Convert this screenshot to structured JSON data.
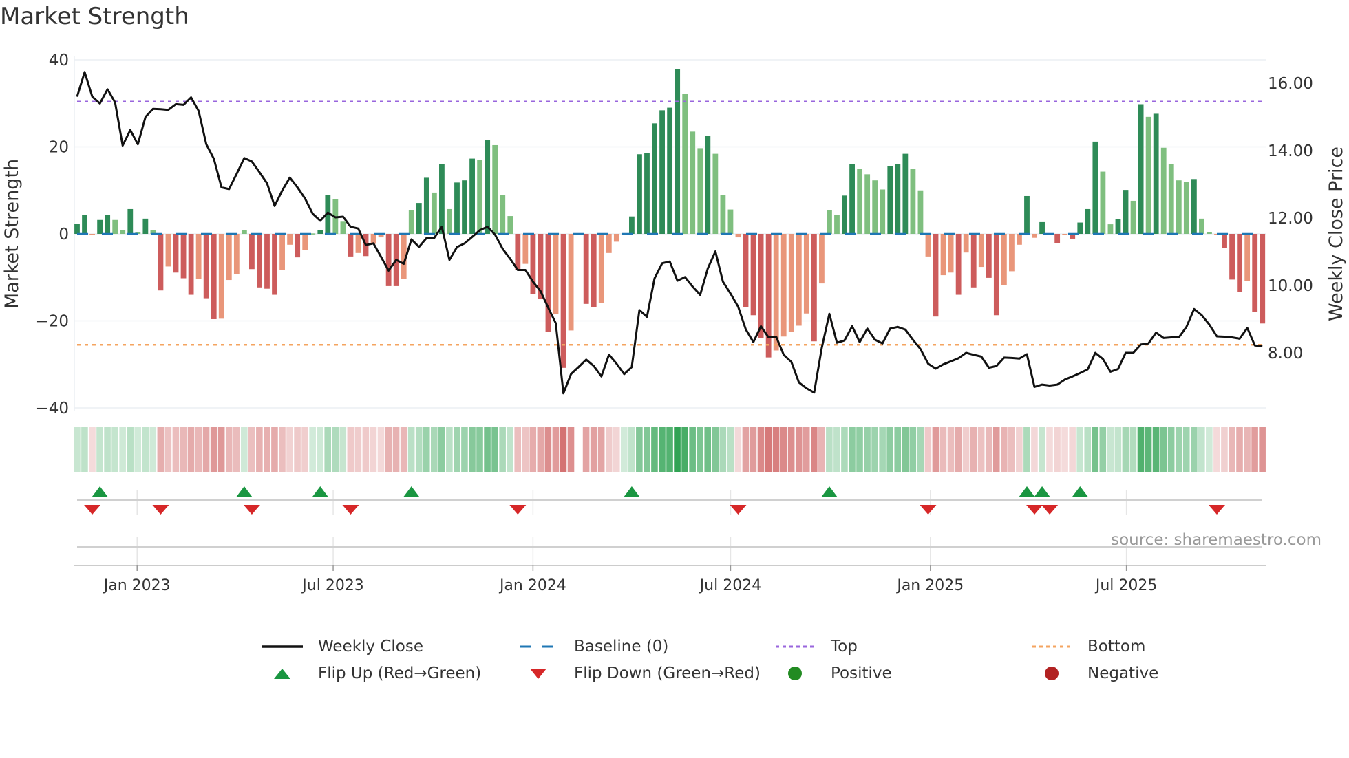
{
  "chart_data": {
    "type": "bar",
    "title": "Market Strength",
    "ylabel": "Market Strength",
    "y2label": "Weekly Close Price",
    "ylim": [
      -40,
      40
    ],
    "y2lim": [
      6.38,
      16.69
    ],
    "yticks": [
      "40",
      "20",
      "0",
      "−20",
      "−40"
    ],
    "ytick_values": [
      40,
      20,
      0,
      -20,
      -40
    ],
    "y2ticks": [
      "16.00",
      "14.00",
      "12.00",
      "10.00",
      "8.00"
    ],
    "y2tick_values": [
      16,
      14,
      12,
      10,
      8
    ],
    "xticks": [
      {
        "label": "Jan 2023",
        "week": 7.9
      },
      {
        "label": "Jul 2023",
        "week": 33.7
      },
      {
        "label": "Jan 2024",
        "week": 60.0
      },
      {
        "label": "Jul 2024",
        "week": 86.0
      },
      {
        "label": "Jan 2025",
        "week": 112.3
      },
      {
        "label": "Jul 2025",
        "week": 138.1
      }
    ],
    "top_level": 30.4,
    "bottom_level": -25.5,
    "baseline": 0,
    "strength": [
      2.3,
      4.4,
      -0.2,
      3.2,
      4.3,
      3.2,
      0.9,
      5.7,
      0.4,
      3.5,
      0.8,
      -13,
      -7.5,
      -8.9,
      -10.2,
      -14,
      -10.4,
      -14.8,
      -19.6,
      -19.5,
      -10.6,
      -9.2,
      0.8,
      -8.1,
      -12.3,
      -12.6,
      -14,
      -8.3,
      -2.5,
      -5.4,
      -3.7,
      0.1,
      0.9,
      9,
      8,
      2.8,
      -5.2,
      -4.4,
      -5.1,
      -2.3,
      -0.8,
      -12,
      -12,
      -10.4,
      5.4,
      7.1,
      12.9,
      9.5,
      16,
      5.7,
      11.8,
      12.3,
      17.3,
      17,
      21.5,
      20.4,
      8.9,
      4.1,
      -8.3,
      -6.9,
      -13.8,
      -15,
      -22.5,
      -18.4,
      -30.8,
      -22.2,
      0,
      -16.1,
      -16.9,
      -15.9,
      -4.4,
      -1.8,
      0.1,
      4,
      18.3,
      18.6,
      25.4,
      28.4,
      29,
      37.9,
      32.1,
      23.5,
      19.7,
      22.5,
      18.4,
      9,
      5.6,
      -0.8,
      -16.8,
      -18.7,
      -23.9,
      -28.4,
      -26.8,
      -23.6,
      -22.6,
      -21.1,
      -18.3,
      -24.7,
      -11.4,
      5.4,
      4.3,
      8.8,
      16,
      15,
      13.7,
      12.3,
      10.2,
      15.6,
      16,
      18.4,
      14.9,
      10,
      -5.2,
      -19,
      -9.5,
      -8.9,
      -14,
      -4.3,
      -12.3,
      -7.6,
      -10.1,
      -18.7,
      -11.7,
      -8.6,
      -2.5,
      8.7,
      -0.9,
      2.7,
      -0.1,
      -2.2,
      -0.1,
      -1.1,
      2.6,
      5.7,
      21.2,
      14.3,
      2.2,
      3.4,
      10.1,
      7.6,
      29.8,
      26.9,
      27.6,
      19.8,
      16,
      12.3,
      11.9,
      12.6,
      3.5,
      0.4,
      -0.3,
      -3.3,
      -10.5,
      -13.3,
      -10.9,
      -18,
      -20.6
    ],
    "weekly_close": [
      15.6,
      16.33,
      15.6,
      15.4,
      15.82,
      15.43,
      14.15,
      14.61,
      14.19,
      15.0,
      15.24,
      15.23,
      15.21,
      15.38,
      15.36,
      15.58,
      15.18,
      14.19,
      13.76,
      12.91,
      12.86,
      13.31,
      13.78,
      13.68,
      13.36,
      13.03,
      12.36,
      12.82,
      13.2,
      12.91,
      12.58,
      12.13,
      11.92,
      12.16,
      12.02,
      12.04,
      11.74,
      11.69,
      11.2,
      11.25,
      10.85,
      10.44,
      10.76,
      10.64,
      11.37,
      11.14,
      11.41,
      11.41,
      11.74,
      10.76,
      11.14,
      11.25,
      11.44,
      11.64,
      11.74,
      11.51,
      11.09,
      10.79,
      10.46,
      10.46,
      10.11,
      9.83,
      9.34,
      8.88,
      6.8,
      7.37,
      7.58,
      7.8,
      7.61,
      7.3,
      7.95,
      7.68,
      7.37,
      7.58,
      9.27,
      9.07,
      10.21,
      10.66,
      10.71,
      10.14,
      10.25,
      9.97,
      9.72,
      10.5,
      11.01,
      10.11,
      9.76,
      9.37,
      8.7,
      8.32,
      8.79,
      8.46,
      8.48,
      7.94,
      7.73,
      7.12,
      6.95,
      6.82,
      8.14,
      9.16,
      8.3,
      8.37,
      8.79,
      8.32,
      8.72,
      8.39,
      8.28,
      8.72,
      8.77,
      8.69,
      8.39,
      8.11,
      7.68,
      7.53,
      7.66,
      7.75,
      7.84,
      8.0,
      7.94,
      7.89,
      7.56,
      7.61,
      7.86,
      7.85,
      7.83,
      7.96,
      6.99,
      7.06,
      7.03,
      7.06,
      7.21,
      7.3,
      7.4,
      7.51,
      8.0,
      7.82,
      7.44,
      7.52,
      8.0,
      8.0,
      8.25,
      8.28,
      8.6,
      8.44,
      8.46,
      8.46,
      8.77,
      9.3,
      9.12,
      8.84,
      8.49,
      8.48,
      8.46,
      8.42,
      8.74,
      8.22,
      8.2
    ],
    "flip_up_weeks": [
      3,
      22,
      32,
      44,
      73,
      99,
      125,
      127,
      132
    ],
    "flip_down_weeks": [
      2,
      11,
      23,
      36,
      58,
      87,
      112,
      126,
      128,
      150
    ],
    "legend": [
      {
        "label": "Weekly Close",
        "symbol": "line"
      },
      {
        "label": "Baseline (0)",
        "symbol": "dash"
      },
      {
        "label": "Top",
        "symbol": "dot-purple"
      },
      {
        "label": "Bottom",
        "symbol": "dot-orange"
      },
      {
        "label": "Flip Up (Red→Green)",
        "symbol": "triangle-up"
      },
      {
        "label": "Flip Down (Green→Red)",
        "symbol": "triangle-down"
      },
      {
        "label": "Positive",
        "symbol": "circle-green"
      },
      {
        "label": "Negative",
        "symbol": "circle-red"
      }
    ],
    "legend_position": "bottom",
    "annotation": "source: sharemaestro.com"
  },
  "colors": {
    "pos_strong": "#2e8b57",
    "pos_weak": "#7fbf7f",
    "neg_strong": "#cd5c5c",
    "neg_weak": "#e9967a",
    "close": "#111111",
    "baseline": "#1f77b4",
    "top": "#9966dd",
    "bottom": "#f4a460",
    "flip_up": "#1a9641",
    "flip_down": "#d62728",
    "positive": "#228b22",
    "negative": "#b22222"
  }
}
